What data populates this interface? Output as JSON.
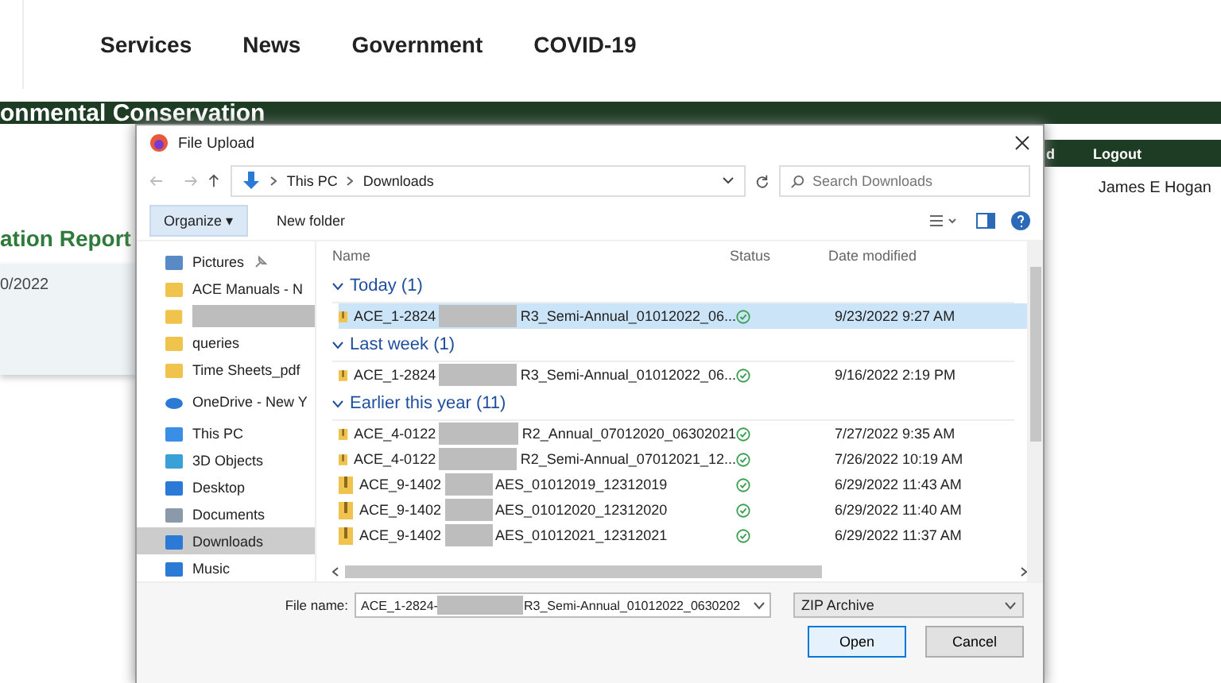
{
  "site": {
    "nav": [
      "Services",
      "News",
      "Government",
      "COVID-19"
    ],
    "banner_title": "onmental Conservation",
    "subbar": [
      "d",
      "Logout"
    ],
    "user": "James E Hogan",
    "section_title": "ation Report",
    "date": "0/2022"
  },
  "dialog": {
    "title": "File Upload",
    "breadcrumb": [
      "This PC",
      "Downloads"
    ],
    "search": {
      "placeholder": "Search Downloads"
    },
    "commands": [
      {
        "label": "Organize ▾",
        "kind": "menu"
      },
      {
        "label": "New folder",
        "kind": "plain"
      }
    ],
    "sidebar": [
      {
        "kind": "pictures",
        "label": "Pictures",
        "pinned": true,
        "selected": false
      },
      {
        "kind": "folder",
        "label": "ACE Manuals - N",
        "selected": false
      },
      {
        "kind": "folder",
        "redacted": true,
        "selected": false
      },
      {
        "kind": "folder",
        "label": "queries",
        "selected": false
      },
      {
        "kind": "folder",
        "label": "Time Sheets_pdf",
        "selected": false
      },
      {
        "kind": "cloud",
        "label": "OneDrive - New Y",
        "selected": false
      },
      {
        "kind": "pc",
        "label": "This PC",
        "selected": false
      },
      {
        "kind": "objects",
        "label": "3D Objects",
        "selected": false
      },
      {
        "kind": "desktop",
        "label": "Desktop",
        "selected": false
      },
      {
        "kind": "documents",
        "label": "Documents",
        "selected": false
      },
      {
        "kind": "downloads",
        "label": "Downloads",
        "selected": true
      },
      {
        "kind": "music",
        "label": "Music",
        "selected": false
      }
    ],
    "columns": [
      "Name",
      "Status",
      "Date modified"
    ],
    "groups": [
      {
        "label": "Today (1)",
        "files": [
          {
            "prefix": "ACE_1-2824",
            "suffix": "R3_Semi-Annual_01012022_06...",
            "synced": true,
            "date": "9/23/2022 9:27 AM",
            "selected": true
          }
        ]
      },
      {
        "label": "Last week (1)",
        "files": [
          {
            "prefix": "ACE_1-2824",
            "suffix": "R3_Semi-Annual_01012022_06...",
            "synced": true,
            "date": "9/16/2022 2:19 PM",
            "selected": false
          }
        ]
      },
      {
        "label": "Earlier this year (11)",
        "files": [
          {
            "prefix": "ACE_4-0122",
            "suffix": "R2_Annual_07012020_06302021",
            "synced": true,
            "date": "7/27/2022 9:35 AM",
            "selected": false
          },
          {
            "prefix": "ACE_4-0122",
            "suffix": "R2_Semi-Annual_07012021_12...",
            "synced": true,
            "date": "7/26/2022 10:19 AM",
            "selected": false
          },
          {
            "prefix": "ACE_9-1402",
            "suffix": "AES_01012019_12312019",
            "synced": true,
            "date": "6/29/2022 11:43 AM",
            "selected": false
          },
          {
            "prefix": "ACE_9-1402",
            "suffix": "AES_01012020_12312020",
            "synced": true,
            "date": "6/29/2022 11:40 AM",
            "selected": false
          },
          {
            "prefix": "ACE_9-1402",
            "suffix": "AES_01012021_12312021",
            "synced": true,
            "date": "6/29/2022 11:37 AM",
            "selected": false
          }
        ]
      }
    ],
    "footer": {
      "file_name_label": "File name:",
      "file_name_prefix": "ACE_1-2824-",
      "file_name_suffix": "R3_Semi-Annual_01012022_0630202",
      "file_type": "ZIP Archive",
      "buttons": [
        {
          "label": "Open",
          "default": true
        },
        {
          "label": "Cancel",
          "default": false
        }
      ]
    }
  }
}
